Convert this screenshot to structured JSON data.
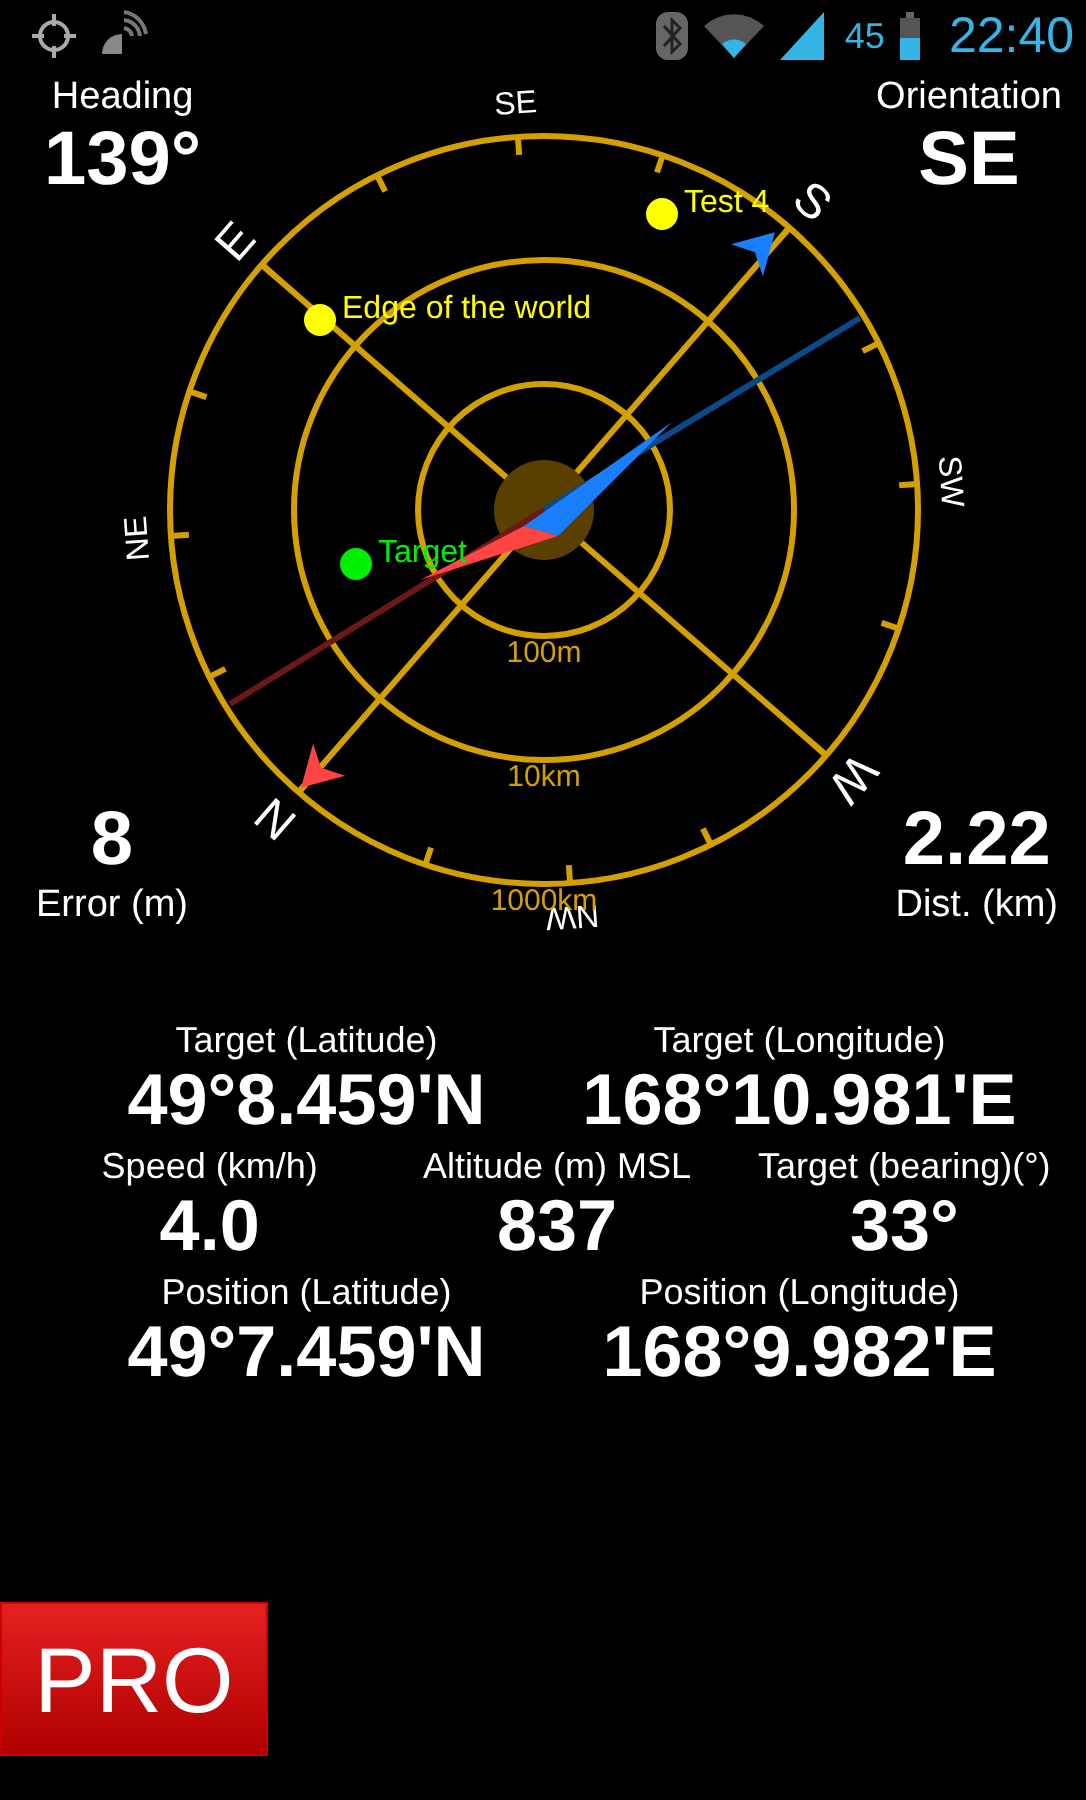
{
  "status_bar": {
    "battery_text": "45",
    "time": "22:40"
  },
  "corners": {
    "heading": {
      "label": "Heading",
      "value": "139°"
    },
    "orientation": {
      "label": "Orientation",
      "value": "SE"
    },
    "error": {
      "label": "Error (m)",
      "value": "8"
    },
    "distance": {
      "label": "Dist. (km)",
      "value": "2.22"
    }
  },
  "compass": {
    "directions": [
      "N",
      "NE",
      "E",
      "SE",
      "S",
      "SW",
      "W",
      "NW"
    ],
    "ring_labels": [
      "100m",
      "10km",
      "1000km"
    ],
    "waypoints": [
      {
        "name": "Test 4",
        "color": "#ffff00"
      },
      {
        "name": "Edge of the world",
        "color": "#ffff00"
      },
      {
        "name": "Target",
        "color": "#00ee00"
      }
    ]
  },
  "readouts": [
    [
      {
        "label": "Target (Latitude)",
        "value": "49°8.459'N"
      },
      {
        "label": "Target (Longitude)",
        "value": "168°10.981'E"
      }
    ],
    [
      {
        "label": "Speed (km/h)",
        "value": "4.0"
      },
      {
        "label": "Altitude (m) MSL",
        "value": "837"
      },
      {
        "label": "Target (bearing)(°)",
        "value": "33°"
      }
    ],
    [
      {
        "label": "Position (Latitude)",
        "value": "49°7.459'N"
      },
      {
        "label": "Position (Longitude)",
        "value": "168°9.982'E"
      }
    ]
  ],
  "pro_button": "PRO"
}
